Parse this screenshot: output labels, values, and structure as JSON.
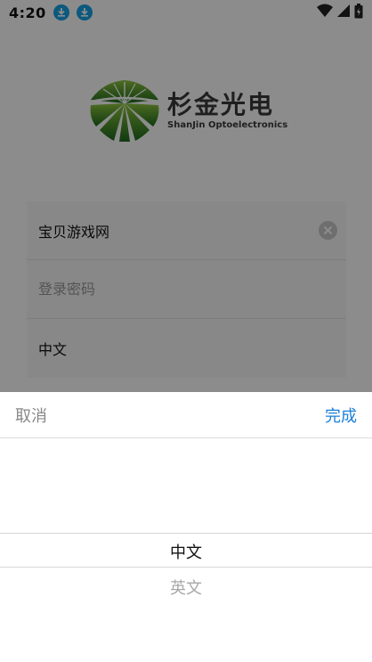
{
  "status_bar": {
    "time": "4:20"
  },
  "logo": {
    "cn": "杉金光电",
    "en": "ShanJin Optoelectronics"
  },
  "form": {
    "username_value": "宝贝游戏网",
    "password_placeholder": "登录密码",
    "language_value": "中文"
  },
  "picker": {
    "cancel_label": "取消",
    "done_label": "完成",
    "options": [
      "中文",
      "英文"
    ],
    "selected_index": 0
  },
  "colors": {
    "done_blue": "#1a7fd9",
    "download_icon": "#17a2e6",
    "logo_green": "#2f7d28"
  }
}
